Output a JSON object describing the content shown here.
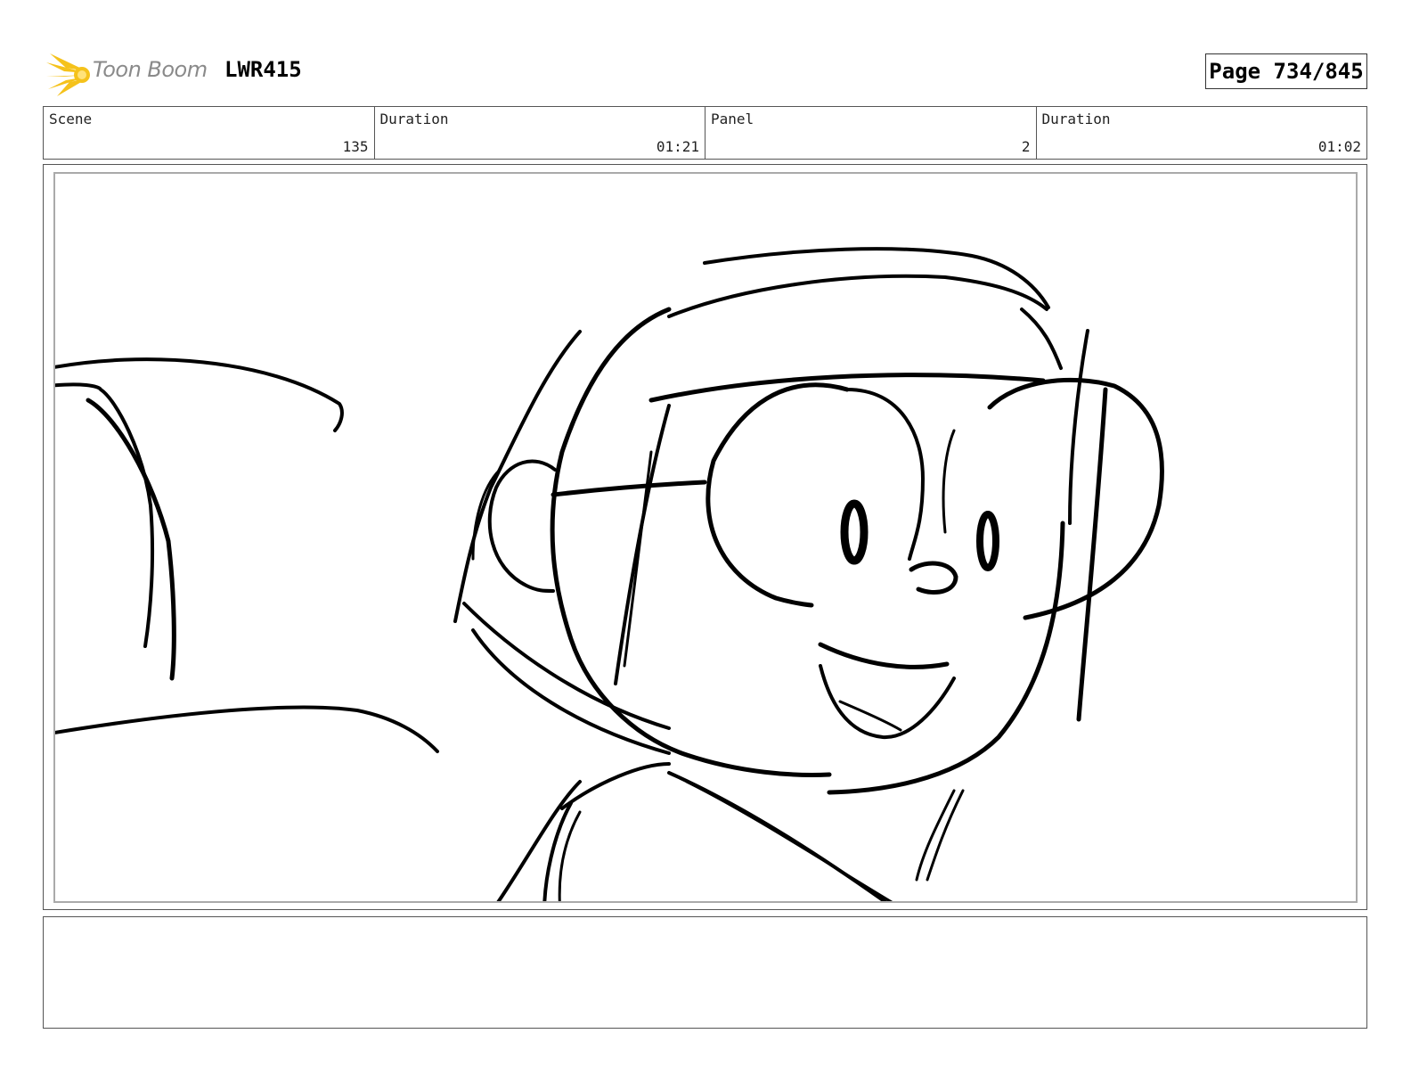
{
  "header": {
    "logo_text": "Toon Boom",
    "project_title": "LWR415",
    "page_label": "Page 734/845"
  },
  "info": {
    "scene_label": "Scene",
    "scene_value": "135",
    "scene_duration_label": "Duration",
    "scene_duration_value": "01:21",
    "panel_label": "Panel",
    "panel_value": "2",
    "panel_duration_label": "Duration",
    "panel_duration_value": "01:02"
  },
  "caption": {
    "text": ""
  },
  "colors": {
    "logo_accent": "#f5c21b",
    "logo_text": "#8a8a8a",
    "frame_border": "#555555",
    "inner_border": "#aaaaaa"
  },
  "icons": {
    "logo": "toon-boom-burst-icon"
  }
}
